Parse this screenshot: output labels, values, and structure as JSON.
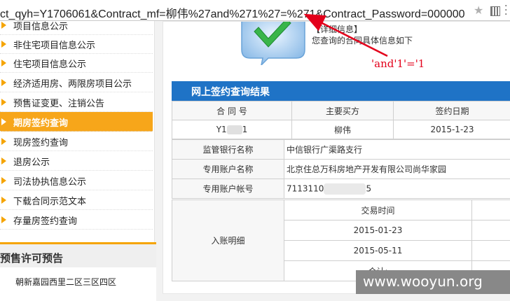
{
  "browser": {
    "url": "ct_qyh=Y1706061&Contract_mf=柳伟%27and%271%27=%271&Contract_Password=000000"
  },
  "sidebar": {
    "items": [
      {
        "label": "项目信息公示",
        "active": false
      },
      {
        "label": "非住宅项目信息公示",
        "active": false
      },
      {
        "label": "住宅项目信息公示",
        "active": false
      },
      {
        "label": "经济适用房、两限房项目公示",
        "active": false
      },
      {
        "label": "预售证变更、注销公告",
        "active": false
      },
      {
        "label": "期房签约查询",
        "active": true
      },
      {
        "label": "现房签约查询",
        "active": false
      },
      {
        "label": "退房公示",
        "active": false
      },
      {
        "label": "司法协执信息公示",
        "active": false
      },
      {
        "label": "下载合同示范文本",
        "active": false
      },
      {
        "label": "存量房签约查询",
        "active": false
      }
    ],
    "presale_title": "预售许可预告",
    "presale_item": "朝新嘉园西里二区三区四区"
  },
  "main": {
    "detail_title": "【详细信息】",
    "detail_desc": "您查询的合同具体信息如下",
    "panel_title": "网上签约查询结果",
    "contract_headers": [
      "合 同 号",
      "主要买方",
      "签约日期"
    ],
    "contract_row": {
      "number_prefix": "Y1",
      "number_suffix": "1",
      "buyer": "柳伟",
      "date": "2015-1-23"
    },
    "bank_label": "监管银行名称",
    "bank_value": "中信银行广渠路支行",
    "account_name_label": "专用账户名称",
    "account_name_value": "北京住总万科房地产开发有限公司尚华家园",
    "account_no_label": "专用账户帐号",
    "account_no_prefix": "7113110",
    "account_no_suffix": "5",
    "inflow_label": "入账明细",
    "inflow_header": "交易时间",
    "inflow_dates": [
      "2015-01-23",
      "2015-05-11"
    ],
    "inflow_total": "合计:"
  },
  "annotation": {
    "text": "'and'1'='1"
  },
  "watermark": "www.wooyun.org",
  "colors": {
    "accent": "#f7a61a",
    "panel": "#1f73c6",
    "annotation": "#e3001b"
  }
}
